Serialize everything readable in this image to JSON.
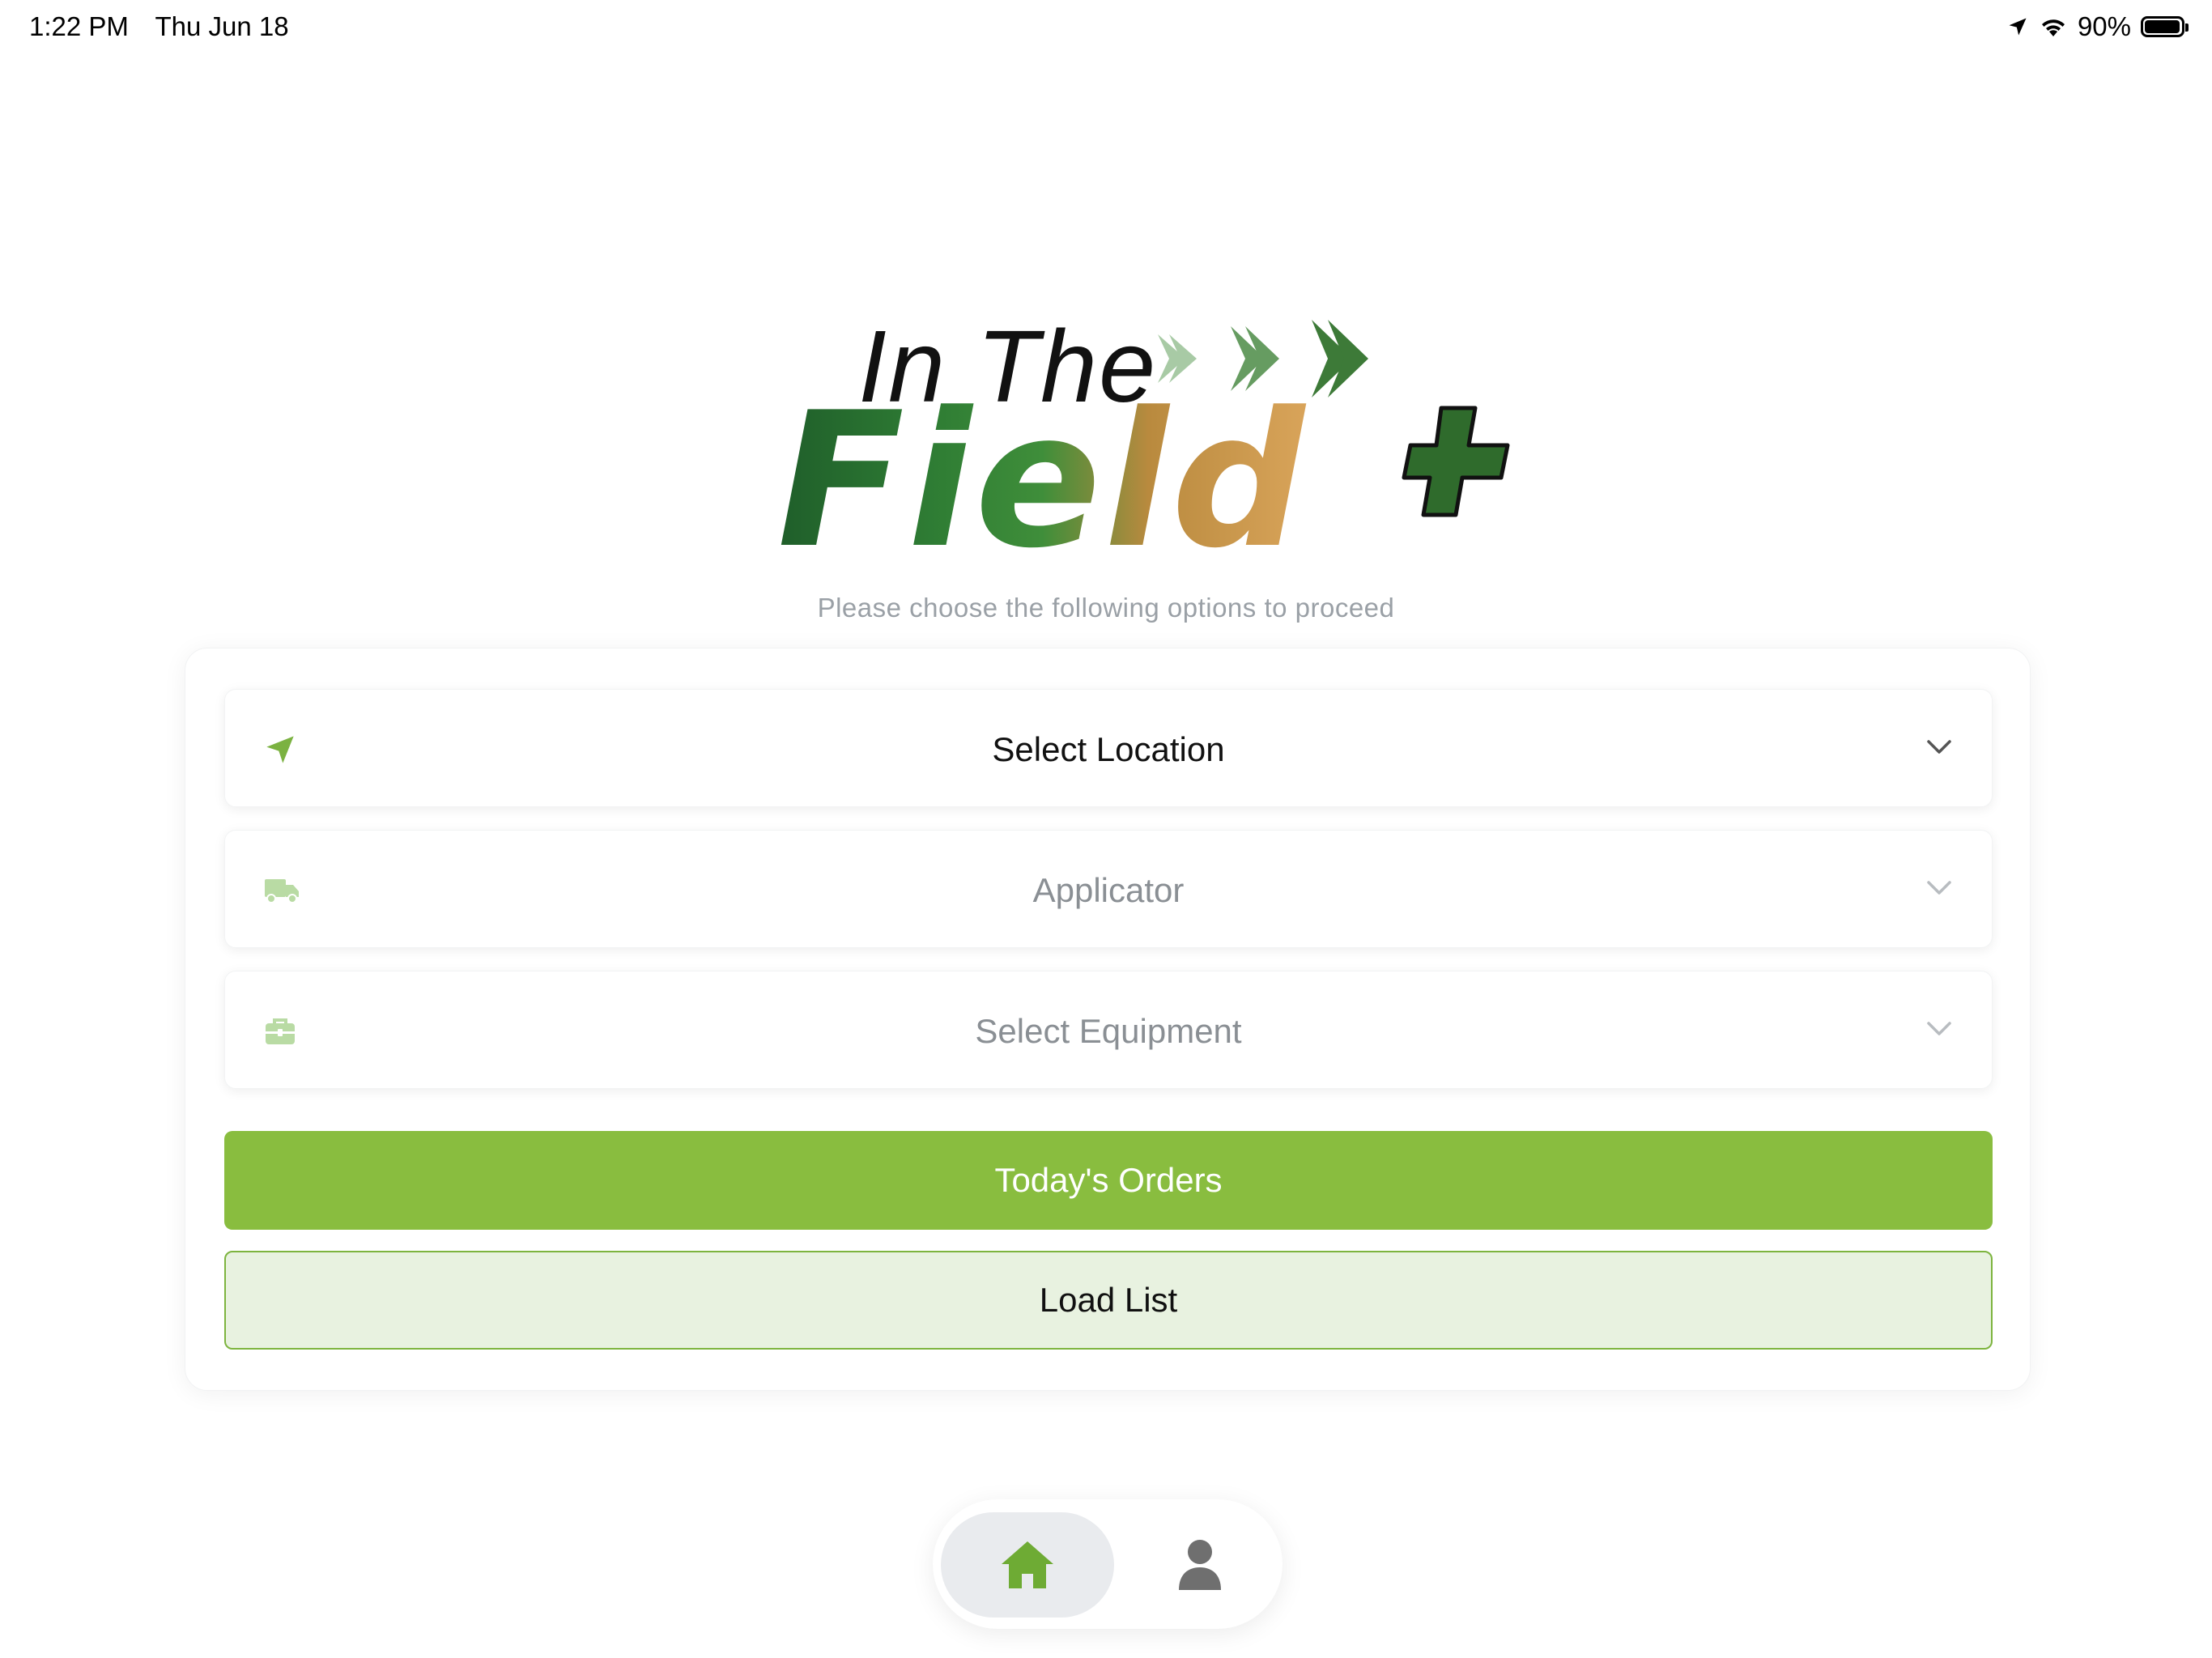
{
  "status_bar": {
    "time": "1:22 PM",
    "date": "Thu Jun 18",
    "battery": "90%",
    "battery_level": 0.9,
    "icons": [
      "location-arrow-icon",
      "wifi-icon",
      "battery-icon"
    ]
  },
  "logo": {
    "line1": "In The",
    "line2": "Field",
    "mark": "+"
  },
  "subtitle": "Please choose the following options to proceed",
  "selectors": [
    {
      "label": "Select Location",
      "icon": "location-arrow-icon",
      "active": true
    },
    {
      "label": "Applicator",
      "icon": "truck-icon",
      "active": false
    },
    {
      "label": "Select Equipment",
      "icon": "toolbox-icon",
      "active": false
    }
  ],
  "buttons": {
    "primary": "Today's Orders",
    "secondary": "Load List"
  },
  "nav": {
    "items": [
      "home-icon",
      "user-icon"
    ],
    "active": "home-icon"
  },
  "colors": {
    "accent": "#89bd3f",
    "accent_light": "#e8f2e0",
    "logo_green": "#2f6b2c",
    "muted_text": "#8a8f94"
  }
}
